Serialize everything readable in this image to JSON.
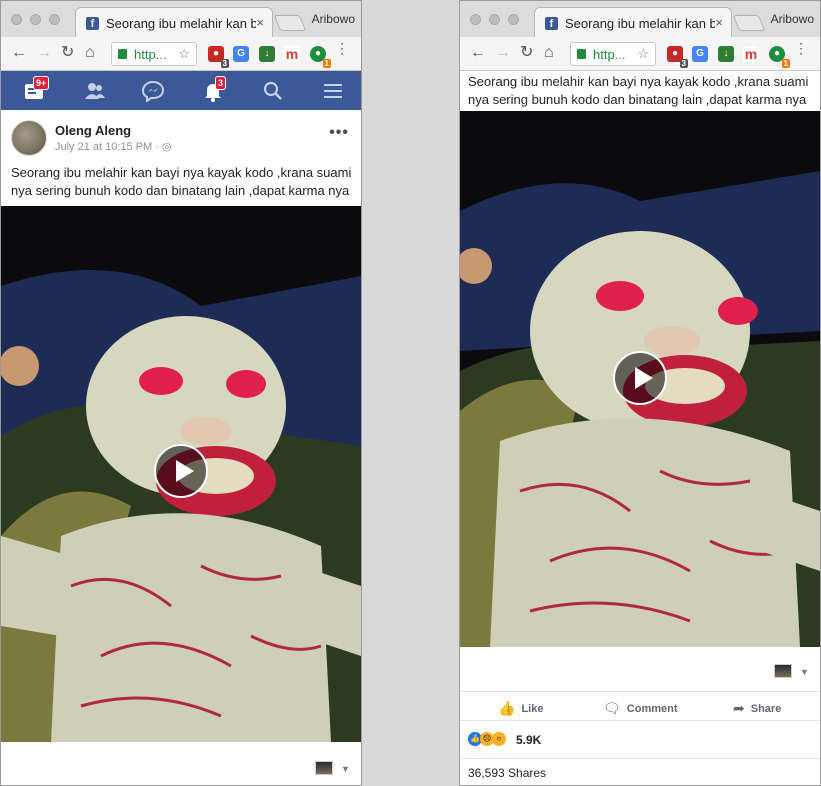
{
  "browser": {
    "tab_title": "Seorang ibu melahir kan bayi nya kayak kodo ,krana suami nya sering bunuh kodo dan binatang lain ,dapat karma nya",
    "tab_close": "×",
    "profile_name": "Aribowo",
    "url_text": "http",
    "url_trail": "...",
    "extensions": [
      {
        "icon": "shield-extension-icon",
        "color": "#c62828",
        "count": "3"
      },
      {
        "icon": "translate-extension-icon",
        "color": "#4285f4",
        "count": ""
      },
      {
        "icon": "download-extension-icon",
        "color": "#2e7d32",
        "count": ""
      },
      {
        "icon": "m-extension-icon",
        "label": "m",
        "color": "#e53935",
        "count": ""
      },
      {
        "icon": "g-extension-icon",
        "color": "#1e8e3e",
        "count": "1"
      }
    ]
  },
  "fb_nav": {
    "feed_badge": "9+",
    "notifications_badge": "3"
  },
  "post": {
    "author": "Oleng Aleng",
    "timestamp": "July 21 at 10:15 PM",
    "caption": "Seorang ibu melahir kan bayi nya kayak kodo ,krana suami nya sering bunuh kodo dan binatang lain ,dapat karma nya",
    "actions": {
      "like": "Like",
      "comment": "Comment",
      "share": "Share"
    },
    "reaction_count": "5.9K",
    "shares": "36,593 Shares"
  }
}
